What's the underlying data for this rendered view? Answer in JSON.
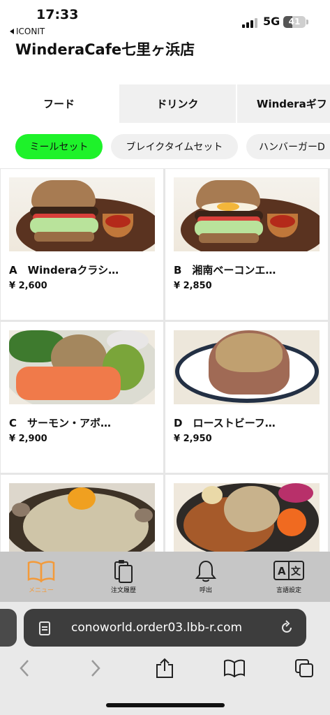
{
  "status_bar": {
    "time": "17:33",
    "back_app": "ICONIT",
    "network": "5G",
    "battery": "41",
    "battery_level": 0.41
  },
  "store": {
    "title": "WinderaCafe七里ヶ浜店"
  },
  "tabs": [
    {
      "label": "フード",
      "active": true
    },
    {
      "label": "ドリンク",
      "active": false
    },
    {
      "label": "Winderaギフ",
      "active": false
    }
  ],
  "categories": [
    {
      "label": "ミールセット",
      "active": true
    },
    {
      "label": "ブレイクタイムセット",
      "active": false
    },
    {
      "label": "ハンバーガーD",
      "active": false
    }
  ],
  "items": [
    {
      "name": "A　Winderaクラシ…",
      "price": "¥ 2,600",
      "photo": "burger-with-salad-and-sauce"
    },
    {
      "name": "B　湘南ベーコンエ…",
      "price": "¥ 2,850",
      "photo": "bacon-egg-burger"
    },
    {
      "name": "C　サーモン・アボ…",
      "price": "¥ 2,900",
      "photo": "salmon-avocado-rice-plate"
    },
    {
      "name": "D　ローストビーフ…",
      "price": "¥ 2,950",
      "photo": "roast-beef-mound"
    },
    {
      "name": "",
      "price": "",
      "photo": "shirasu-pasta-with-clams"
    },
    {
      "name": "",
      "price": "",
      "photo": "curry-rice-plate"
    }
  ],
  "bottom_nav": [
    {
      "label": "メニュー",
      "icon": "book-icon",
      "active": true
    },
    {
      "label": "注文履歴",
      "icon": "clipboard-icon",
      "active": false
    },
    {
      "label": "呼出",
      "icon": "bell-icon",
      "active": false
    },
    {
      "label": "言語設定",
      "icon": "translate-icon",
      "active": false
    }
  ],
  "browser": {
    "url": "conoworld.order03.lbb-r.com"
  },
  "colors": {
    "accent_green": "#1ef22a",
    "active_nav_orange": "#f39a3a",
    "nav_bg": "#c6c6c6"
  }
}
